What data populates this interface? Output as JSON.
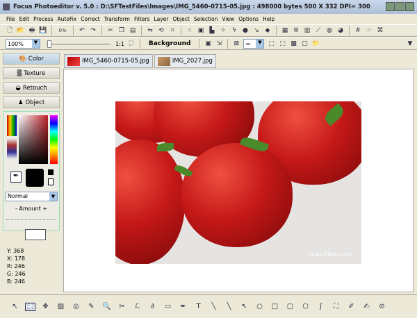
{
  "title": "Focus Photoeditor v. 5.0 :  D:\\SFTestFiles\\Images\\IMG_5460-0715-05.jpg : 498000 bytes    500 X 332 DPI= 300",
  "menu": [
    "File",
    "Edit",
    "Process",
    "AutoFix",
    "Correct",
    "Transform",
    "Filters",
    "Layer",
    "Object",
    "Selection",
    "View",
    "Options",
    "Help"
  ],
  "toolbar1": [
    "new-icon",
    "open-icon",
    "print-icon",
    "save-icon",
    "|",
    "0%",
    "|",
    "undo-icon",
    "redo-icon",
    "|",
    "cut-icon",
    "copy-icon",
    "paste-icon",
    "|",
    "flip-icon",
    "rotate-icon",
    "crop-icon",
    "|",
    "stamp-icon",
    "frame-icon",
    "layer-icon",
    "wand-icon",
    "brush-icon",
    "ball-icon",
    "arrow-icon",
    "diamond-icon",
    "|",
    "photo-icon",
    "gear-icon",
    "panel-icon",
    "curve-icon",
    "effects-icon",
    "color-wheel-icon",
    "|",
    "grid-icon",
    "dots-icon",
    "grid2-icon"
  ],
  "toolbar1_glyphs": [
    "🗋",
    "📂",
    "🖶",
    "💾",
    "",
    "◌",
    "",
    "↶",
    "↷",
    "",
    "✂",
    "❐",
    "▤",
    "",
    "⇋",
    "⟲",
    "⌗",
    "",
    "☝",
    "▣",
    "▙",
    "✧",
    "ϟ",
    "●",
    "↘",
    "◆",
    "",
    "▦",
    "⚙",
    "▥",
    "⟋",
    "◍",
    "◕",
    "",
    "#",
    "⁘",
    "⌘"
  ],
  "zoom": {
    "value": "100%",
    "ratio": "1:1",
    "position": 0.02
  },
  "layer_label": "Background",
  "combo_value": "=",
  "panels": [
    {
      "label": "Color",
      "icon": "palette-icon",
      "glyph": "🎨"
    },
    {
      "label": "Texture",
      "icon": "texture-icon",
      "glyph": "▒"
    },
    {
      "label": "Retouch",
      "icon": "retouch-icon",
      "glyph": "◒"
    },
    {
      "label": "Object",
      "icon": "object-icon",
      "glyph": "♟"
    }
  ],
  "blend_mode": "Normal",
  "amount_label": "- Amount +",
  "readout": {
    "y": "Y: 368",
    "x": "X: 178",
    "r": "R: 246",
    "g": "G: 246",
    "b": "B: 246"
  },
  "tabs": [
    {
      "label": "IMG_5460-0715-05.jpg",
      "active": true
    },
    {
      "label": "IMG_2027.jpg",
      "active": false
    }
  ],
  "watermark": "snapfiles.com",
  "colors": {
    "foreground": "#000000",
    "accent": "#c41818"
  },
  "bottom_tools": [
    "pointer-icon",
    "select-icon",
    "move-icon",
    "eraser-icon",
    "lasso-icon",
    "magic-wand-icon",
    "zoom-icon",
    "scissors-icon",
    "freehand-lasso-icon",
    "free-select-icon",
    "rect-select-icon",
    "eyedropper-icon",
    "text-icon",
    "line-icon",
    "thin-line-icon",
    "arrow-line-icon",
    "ellipse-icon",
    "rectangle-icon",
    "rounded-rect-icon",
    "polygon-icon",
    "spiral-icon",
    "fill-icon",
    "color-replace-icon",
    "brush-icon",
    "clone-icon"
  ],
  "bottom_glyphs": [
    "↖",
    "⬚",
    "✥",
    "▨",
    "◎",
    "✎",
    "🔍",
    "✂",
    "ℒ",
    "∂",
    "▭",
    "✒",
    "T",
    "╲",
    "╲",
    "↖",
    "○",
    "□",
    "▢",
    "⬡",
    "ʃ",
    "⛶",
    "✐",
    "✍",
    "⊘"
  ]
}
